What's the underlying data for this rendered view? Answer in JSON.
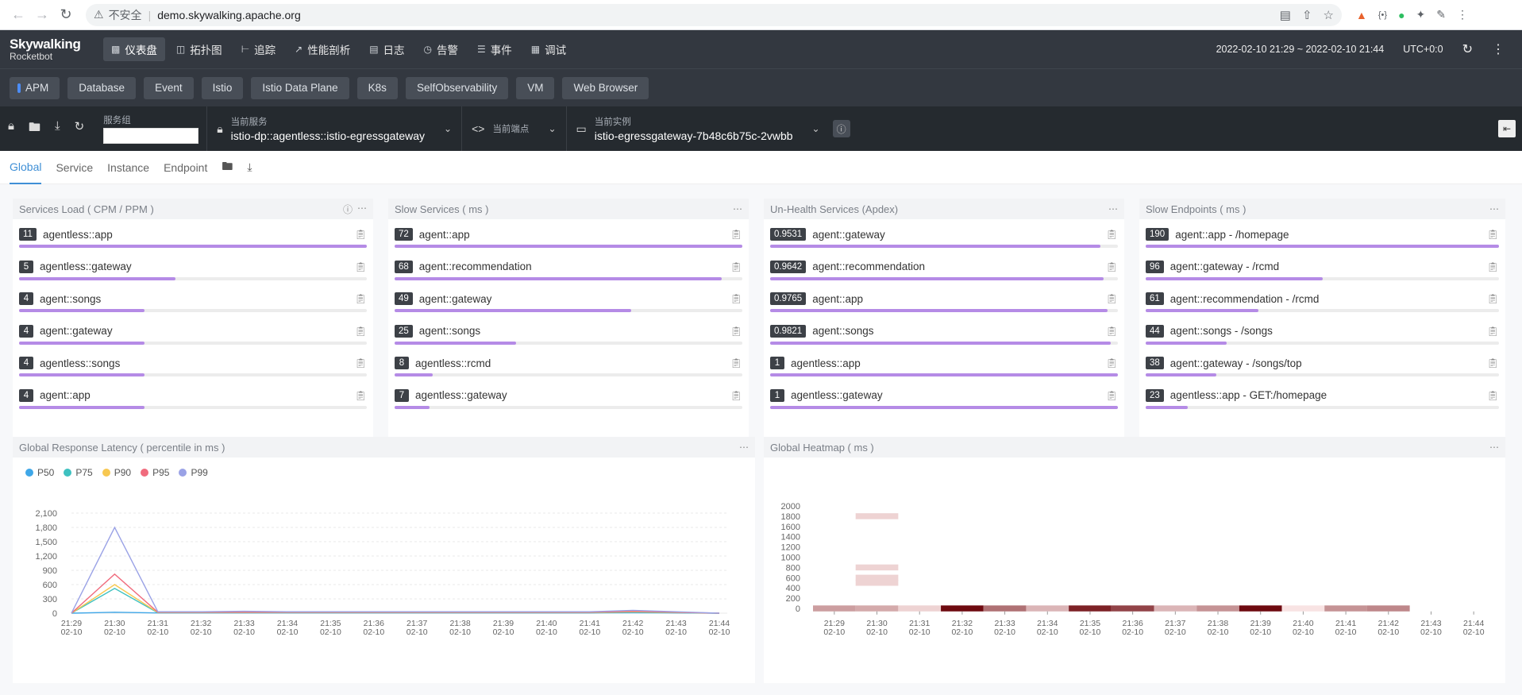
{
  "browser": {
    "insecure_label": "不安全",
    "url": "demo.skywalking.apache.org"
  },
  "app": {
    "logo_line1": "Skywalking",
    "logo_line2": "Rocketbot",
    "nav": [
      {
        "label": "仪表盘",
        "icon": "dashboard-icon",
        "active": true
      },
      {
        "label": "拓扑图",
        "icon": "topology-icon"
      },
      {
        "label": "追踪",
        "icon": "trace-icon"
      },
      {
        "label": "性能剖析",
        "icon": "profile-icon"
      },
      {
        "label": "日志",
        "icon": "log-icon"
      },
      {
        "label": "告警",
        "icon": "alarm-icon"
      },
      {
        "label": "事件",
        "icon": "event-icon"
      },
      {
        "label": "调试",
        "icon": "debug-icon"
      }
    ],
    "time_range": "2022-02-10 21:29 ~ 2022-02-10 21:44",
    "timezone": "UTC+0:0"
  },
  "layers": [
    "APM",
    "Database",
    "Event",
    "Istio",
    "Istio Data Plane",
    "K8s",
    "SelfObservability",
    "VM",
    "Web Browser"
  ],
  "selectors": {
    "group_label": "服务组",
    "service_label": "当前服务",
    "service_value": "istio-dp::agentless::istio-egressgateway",
    "endpoint_label": "当前端点",
    "instance_label": "当前实例",
    "instance_value": "istio-egressgateway-7b48c6b75c-2vwbb"
  },
  "dash_tabs": [
    "Global",
    "Service",
    "Instance",
    "Endpoint"
  ],
  "panels": {
    "services_load": {
      "title": "Services Load ( CPM / PPM )",
      "items": [
        {
          "value": "11",
          "name": "agentless::app",
          "pct": 100
        },
        {
          "value": "5",
          "name": "agentless::gateway",
          "pct": 45
        },
        {
          "value": "4",
          "name": "agent::songs",
          "pct": 36
        },
        {
          "value": "4",
          "name": "agent::gateway",
          "pct": 36
        },
        {
          "value": "4",
          "name": "agentless::songs",
          "pct": 36
        },
        {
          "value": "4",
          "name": "agent::app",
          "pct": 36
        }
      ]
    },
    "slow_services": {
      "title": "Slow Services ( ms )",
      "items": [
        {
          "value": "72",
          "name": "agent::app",
          "pct": 100
        },
        {
          "value": "68",
          "name": "agent::recommendation",
          "pct": 94
        },
        {
          "value": "49",
          "name": "agent::gateway",
          "pct": 68
        },
        {
          "value": "25",
          "name": "agent::songs",
          "pct": 35
        },
        {
          "value": "8",
          "name": "agentless::rcmd",
          "pct": 11
        },
        {
          "value": "7",
          "name": "agentless::gateway",
          "pct": 10
        }
      ]
    },
    "unhealth_services": {
      "title": "Un-Health Services (Apdex)",
      "items": [
        {
          "value": "0.9531",
          "name": "agent::gateway",
          "pct": 95
        },
        {
          "value": "0.9642",
          "name": "agent::recommendation",
          "pct": 96
        },
        {
          "value": "0.9765",
          "name": "agent::app",
          "pct": 97
        },
        {
          "value": "0.9821",
          "name": "agent::songs",
          "pct": 98
        },
        {
          "value": "1",
          "name": "agentless::app",
          "pct": 100
        },
        {
          "value": "1",
          "name": "agentless::gateway",
          "pct": 100
        }
      ]
    },
    "slow_endpoints": {
      "title": "Slow Endpoints ( ms )",
      "items": [
        {
          "value": "190",
          "name": "agent::app - /homepage",
          "pct": 100
        },
        {
          "value": "96",
          "name": "agent::gateway - /rcmd",
          "pct": 50
        },
        {
          "value": "61",
          "name": "agent::recommendation - /rcmd",
          "pct": 32
        },
        {
          "value": "44",
          "name": "agent::songs - /songs",
          "pct": 23
        },
        {
          "value": "38",
          "name": "agent::gateway - /songs/top",
          "pct": 20
        },
        {
          "value": "23",
          "name": "agentless::app - GET:/homepage",
          "pct": 12
        }
      ]
    },
    "latency_title": "Global Response Latency ( percentile in ms )",
    "heatmap_title": "Global Heatmap ( ms )"
  },
  "chart_data": [
    {
      "type": "line",
      "title": "Global Response Latency ( percentile in ms )",
      "categories": [
        "21:29\n02-10",
        "21:30\n02-10",
        "21:31\n02-10",
        "21:32\n02-10",
        "21:33\n02-10",
        "21:34\n02-10",
        "21:35\n02-10",
        "21:36\n02-10",
        "21:37\n02-10",
        "21:38\n02-10",
        "21:39\n02-10",
        "21:40\n02-10",
        "21:41\n02-10",
        "21:42\n02-10",
        "21:43\n02-10",
        "21:44\n02-10"
      ],
      "ylim": [
        0,
        2100
      ],
      "yticks": [
        0,
        300,
        600,
        900,
        1200,
        1500,
        1800,
        2100
      ],
      "series": [
        {
          "name": "P50",
          "color": "#3fa7e8",
          "values": [
            0,
            20,
            5,
            5,
            5,
            5,
            5,
            5,
            5,
            5,
            5,
            5,
            5,
            10,
            5,
            0
          ]
        },
        {
          "name": "P75",
          "color": "#3ec1c0",
          "values": [
            0,
            520,
            10,
            10,
            10,
            10,
            10,
            10,
            10,
            10,
            10,
            10,
            10,
            20,
            10,
            0
          ]
        },
        {
          "name": "P90",
          "color": "#f7c851",
          "values": [
            0,
            600,
            15,
            15,
            15,
            15,
            15,
            15,
            15,
            15,
            15,
            15,
            15,
            30,
            15,
            0
          ]
        },
        {
          "name": "P95",
          "color": "#f06b7d",
          "values": [
            0,
            820,
            20,
            20,
            20,
            20,
            20,
            20,
            20,
            20,
            20,
            20,
            20,
            40,
            20,
            0
          ]
        },
        {
          "name": "P99",
          "color": "#9aa2e6",
          "values": [
            0,
            1800,
            30,
            30,
            40,
            30,
            30,
            30,
            30,
            30,
            30,
            30,
            30,
            60,
            30,
            0
          ]
        }
      ]
    },
    {
      "type": "heatmap",
      "title": "Global Heatmap ( ms )",
      "categories": [
        "21:29\n02-10",
        "21:30\n02-10",
        "21:31\n02-10",
        "21:32\n02-10",
        "21:33\n02-10",
        "21:34\n02-10",
        "21:35\n02-10",
        "21:36\n02-10",
        "21:37\n02-10",
        "21:38\n02-10",
        "21:39\n02-10",
        "21:40\n02-10",
        "21:41\n02-10",
        "21:42\n02-10",
        "21:43\n02-10",
        "21:44\n02-10"
      ],
      "yticks": [
        0,
        200,
        400,
        600,
        800,
        1000,
        1200,
        1400,
        1600,
        1800,
        2000
      ],
      "base_row_intensity": [
        0.35,
        0.3,
        0.12,
        1.0,
        0.55,
        0.25,
        0.9,
        0.75,
        0.25,
        0.4,
        1.0,
        0.05,
        0.4,
        0.45,
        0,
        0
      ],
      "extra_cells": [
        {
          "col": 1,
          "y": 1800,
          "intensity": 0.12
        },
        {
          "col": 1,
          "y": 800,
          "intensity": 0.12
        },
        {
          "col": 1,
          "y": 600,
          "intensity": 0.12
        },
        {
          "col": 1,
          "y": 500,
          "intensity": 0.12
        }
      ]
    }
  ]
}
